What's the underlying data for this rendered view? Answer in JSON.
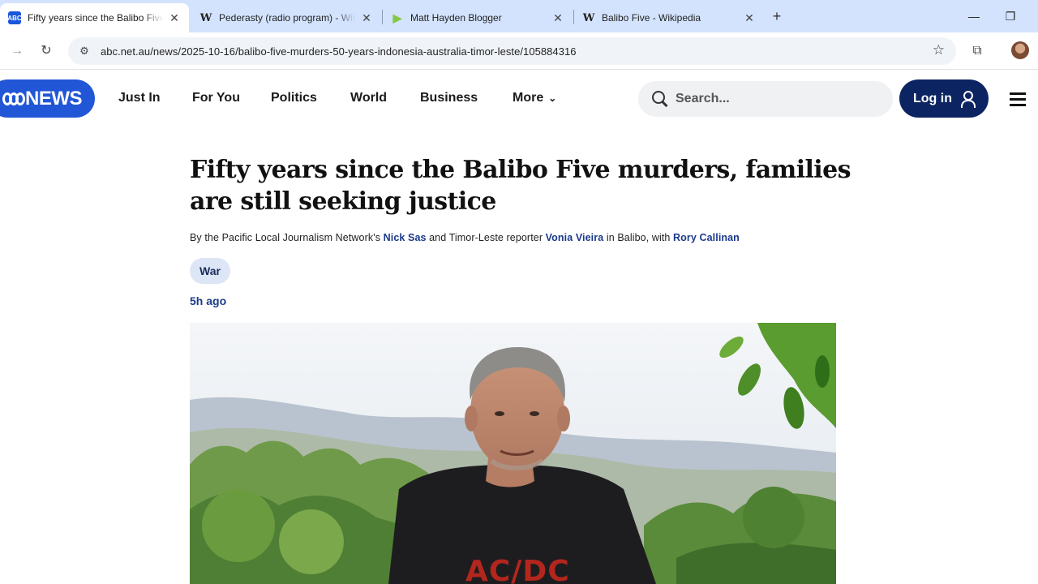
{
  "browser": {
    "tabs": [
      {
        "title": "Fifty years since the Balibo Five",
        "favicon": "abc-news-icon",
        "active": true
      },
      {
        "title": "Pederasty (radio program) - Wikipedia",
        "favicon": "wikipedia-icon",
        "active": false
      },
      {
        "title": "Matt Hayden Blogger",
        "favicon": "rumble-play-icon",
        "active": false
      },
      {
        "title": "Balibo Five - Wikipedia",
        "favicon": "wikipedia-icon",
        "active": false
      }
    ],
    "url": "abc.net.au/news/2025-10-16/balibo-five-murders-50-years-indonesia-australia-timor-leste/105884316"
  },
  "site": {
    "logo_text": "NEWS",
    "nav": [
      "Just In",
      "For You",
      "Politics",
      "World",
      "Business",
      "More"
    ],
    "search_placeholder": "Search...",
    "login_label": "Log in",
    "accent_color": "#2157d6",
    "login_color": "#0c2461"
  },
  "article": {
    "headline": "Fifty years since the Balibo Five murders, families are still seeking justice",
    "byline": {
      "part1": "By the Pacific Local Journalism Network's ",
      "author1": "Nick Sas",
      "part2": " and Timor-Leste reporter ",
      "author2": "Vonia Vieira",
      "part3": " in Balibo, with ",
      "author3": "Rory Callinan"
    },
    "tag": "War",
    "timestamp": "5h ago",
    "hero_shirt_text": "AC/DC"
  }
}
